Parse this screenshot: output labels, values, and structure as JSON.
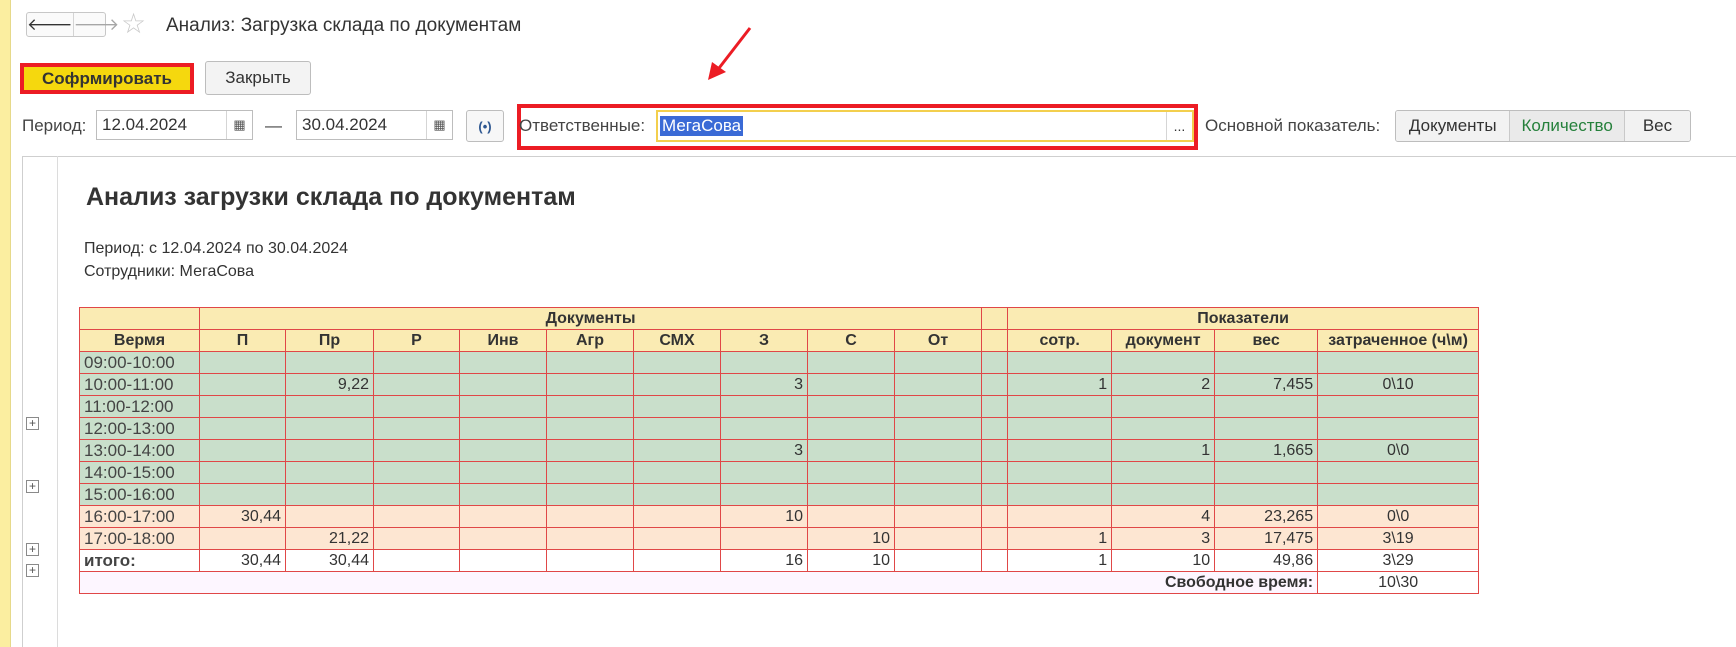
{
  "window": {
    "title": "Анализ: Загрузка склада по документам",
    "back_glyph": "🡐",
    "forward_glyph": "🡒"
  },
  "toolbar": {
    "generate_label": "Софрмировать",
    "close_label": "Закрыть"
  },
  "filters": {
    "period_label": "Период:",
    "date_from": "12.04.2024",
    "date_sep": "—",
    "date_to": "30.04.2024",
    "responsible_label": "Ответственные:",
    "responsible_value": "МегаСова",
    "dots_label": "...",
    "main_indicator_label": "Основной показатель:",
    "indicator_options": [
      "Документы",
      "Количество",
      "Вес"
    ],
    "indicator_selected": "Количество"
  },
  "report": {
    "title": "Анализ загрузки склада по документам",
    "period_line": "Период: с 12.04.2024 по 30.04.2024",
    "employees_line": "Сотрудники: МегаСова",
    "group_docs": "Документы",
    "group_indicators": "Показатели",
    "time_header": "Вермя",
    "doc_columns": [
      "П",
      "Пр",
      "Р",
      "Инв",
      "Агр",
      "СМХ",
      "З",
      "С",
      "От"
    ],
    "ind_columns": [
      "сотр.",
      "документ",
      "вес",
      "затраченное (ч\\м)"
    ],
    "rows": [
      {
        "time": "09:00-10:00",
        "docs": [
          "",
          "",
          "",
          "",
          "",
          "",
          "",
          "",
          ""
        ],
        "ind": [
          "",
          "",
          "",
          ""
        ],
        "type": "g",
        "plus": false
      },
      {
        "time": "10:00-11:00",
        "docs": [
          "",
          "9,22",
          "",
          "",
          "",
          "",
          "3",
          "",
          ""
        ],
        "ind": [
          "1",
          "2",
          "7,455",
          "0\\10"
        ],
        "type": "g",
        "plus": true
      },
      {
        "time": "11:00-12:00",
        "docs": [
          "",
          "",
          "",
          "",
          "",
          "",
          "",
          "",
          ""
        ],
        "ind": [
          "",
          "",
          "",
          ""
        ],
        "type": "g",
        "plus": false
      },
      {
        "time": "12:00-13:00",
        "docs": [
          "",
          "",
          "",
          "",
          "",
          "",
          "",
          "",
          ""
        ],
        "ind": [
          "",
          "",
          "",
          ""
        ],
        "type": "g",
        "plus": false
      },
      {
        "time": "13:00-14:00",
        "docs": [
          "",
          "",
          "",
          "",
          "",
          "",
          "3",
          "",
          ""
        ],
        "ind": [
          "",
          "1",
          "1,665",
          "0\\0"
        ],
        "type": "g",
        "plus": true
      },
      {
        "time": "14:00-15:00",
        "docs": [
          "",
          "",
          "",
          "",
          "",
          "",
          "",
          "",
          ""
        ],
        "ind": [
          "",
          "",
          "",
          ""
        ],
        "type": "g",
        "plus": false
      },
      {
        "time": "15:00-16:00",
        "docs": [
          "",
          "",
          "",
          "",
          "",
          "",
          "",
          "",
          ""
        ],
        "ind": [
          "",
          "",
          "",
          ""
        ],
        "type": "g",
        "plus": false
      },
      {
        "time": "16:00-17:00",
        "docs": [
          "30,44",
          "",
          "",
          "",
          "",
          "",
          "10",
          "",
          ""
        ],
        "ind": [
          "",
          "4",
          "23,265",
          "0\\0"
        ],
        "type": "p",
        "plus": true
      },
      {
        "time": "17:00-18:00",
        "docs": [
          "",
          "21,22",
          "",
          "",
          "",
          "",
          "",
          "10",
          ""
        ],
        "ind": [
          "1",
          "3",
          "17,475",
          "3\\19"
        ],
        "type": "p",
        "plus": true
      }
    ],
    "total": {
      "label": "итого:",
      "docs": [
        "30,44",
        "30,44",
        "",
        "",
        "",
        "",
        "16",
        "10",
        ""
      ],
      "ind": [
        "1",
        "10",
        "49,86",
        "3\\29"
      ]
    },
    "free_time_label": "Свободное время:",
    "free_time_value": "10\\30"
  },
  "colors": {
    "accent_yellow": "#f5d80e",
    "highlight_red": "#ec1c24",
    "row_green": "#c9dfcb",
    "row_peach": "#fde6d2",
    "header_bg": "#faebb3",
    "selected_option": "#25803b"
  }
}
